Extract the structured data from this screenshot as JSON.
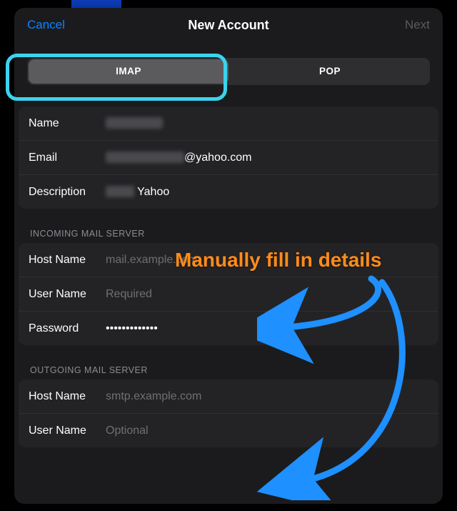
{
  "header": {
    "cancel": "Cancel",
    "title": "New Account",
    "next": "Next"
  },
  "segment": {
    "imap": "IMAP",
    "pop": "POP"
  },
  "account": {
    "name_label": "Name",
    "name_value": "",
    "email_label": "Email",
    "email_suffix": "@yahoo.com",
    "description_label": "Description",
    "description_value": "Yahoo"
  },
  "incoming": {
    "header": "INCOMING MAIL SERVER",
    "host_label": "Host Name",
    "host_placeholder": "mail.example.com",
    "user_label": "User Name",
    "user_placeholder": "Required",
    "password_label": "Password",
    "password_value": "•••••••••••••"
  },
  "outgoing": {
    "header": "OUTGOING MAIL SERVER",
    "host_label": "Host Name",
    "host_placeholder": "smtp.example.com",
    "user_label": "User Name",
    "user_placeholder": "Optional"
  },
  "annotation": {
    "text": "Manually fill in details",
    "color": "#ff8c1a",
    "arrow_color": "#0a84ff"
  }
}
